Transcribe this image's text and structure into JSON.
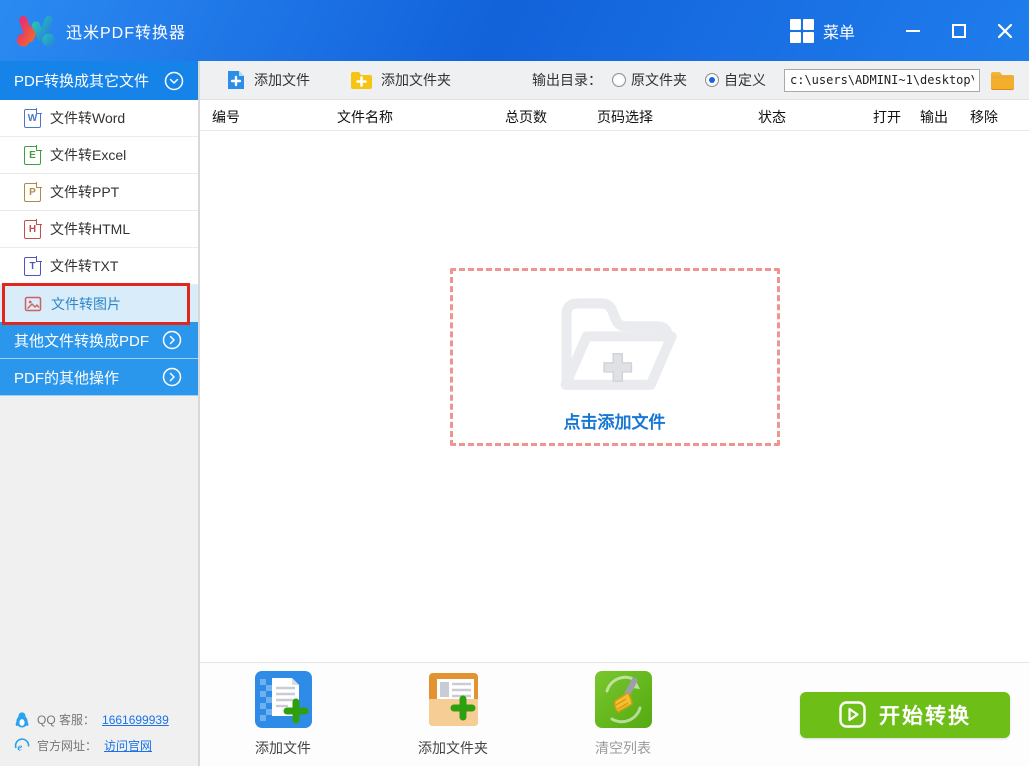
{
  "window": {
    "title": "迅米PDF转换器",
    "menu_label": "菜单"
  },
  "sidebar": {
    "header": {
      "label": "PDF转换成其它文件"
    },
    "items": [
      {
        "label": "文件转Word",
        "letter": "W"
      },
      {
        "label": "文件转Excel",
        "letter": "E"
      },
      {
        "label": "文件转PPT",
        "letter": "P"
      },
      {
        "label": "文件转HTML",
        "letter": "H"
      },
      {
        "label": "文件转TXT",
        "letter": "T"
      },
      {
        "label": "文件转图片",
        "selected": true
      }
    ],
    "sections": [
      {
        "label": "其他文件转换成PDF"
      },
      {
        "label": "PDF的其他操作"
      }
    ],
    "contact": {
      "qq_label": "QQ 客服：",
      "qq_link": "1661699939",
      "site_label": "官方网址：",
      "site_link": "访问官网"
    }
  },
  "toolbar": {
    "add_file": "添加文件",
    "add_folder": "添加文件夹",
    "output_dir_label": "输出目录：",
    "radio_original": "原文件夹",
    "radio_custom": "自定义",
    "selected_radio": "自定义",
    "path_value": "c:\\users\\ADMINI~1\\desktop\\"
  },
  "table": {
    "columns": [
      "编号",
      "文件名称",
      "总页数",
      "页码选择",
      "状态",
      "打开",
      "输出",
      "移除"
    ]
  },
  "dropzone": {
    "label": "点击添加文件"
  },
  "bottom": {
    "actions": [
      {
        "label": "添加文件"
      },
      {
        "label": "添加文件夹"
      },
      {
        "label": "清空列表",
        "disabled": true
      }
    ],
    "start_button": "开始转换"
  },
  "colors": {
    "titlebar_blue": "#1668dd",
    "sidebar_header_blue": "#1583e8",
    "section_blue": "#2b97ec",
    "selected_item_bg": "#d8ecfa",
    "selection_annotation_red": "#e1261d",
    "dropzone_dash_pink": "#f19490",
    "dropzone_text_blue": "#1777d3",
    "start_button_green": "#6ebe18",
    "link_blue": "#1a73e8"
  }
}
